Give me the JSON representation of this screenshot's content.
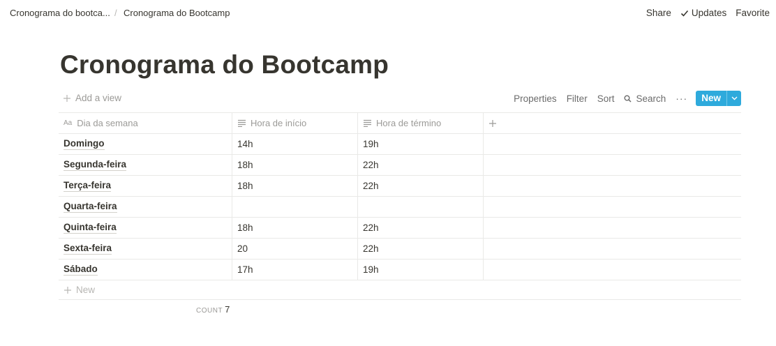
{
  "breadcrumb": {
    "parent": "Cronograma do bootca...",
    "separator": "/",
    "current": "Cronograma do Bootcamp"
  },
  "top_actions": {
    "share": "Share",
    "updates": "Updates",
    "favorite": "Favorite"
  },
  "page": {
    "title": "Cronograma do Bootcamp"
  },
  "view_toolbar": {
    "add_view": "Add a view",
    "properties": "Properties",
    "filter": "Filter",
    "sort": "Sort",
    "search": "Search",
    "more": "···",
    "new": "New"
  },
  "table": {
    "headers": [
      "Dia da semana",
      "Hora de início",
      "Hora de término"
    ],
    "rows": [
      {
        "day": "Domingo",
        "start": "14h",
        "end": "19h"
      },
      {
        "day": "Segunda-feira",
        "start": "18h",
        "end": "22h"
      },
      {
        "day": "Terça-feira",
        "start": "18h",
        "end": "22h"
      },
      {
        "day": "Quarta-feira",
        "start": "",
        "end": ""
      },
      {
        "day": "Quinta-feira",
        "start": "18h",
        "end": "22h"
      },
      {
        "day": "Sexta-feira",
        "start": "20",
        "end": "22h"
      },
      {
        "day": "Sábado",
        "start": "17h",
        "end": "19h"
      }
    ],
    "new_row": "New",
    "count_label": "COUNT",
    "count_value": "7"
  },
  "colors": {
    "accent": "#2eaadc",
    "text": "#37352f",
    "muted": "#9b9a97",
    "border": "#e9e9e7"
  }
}
